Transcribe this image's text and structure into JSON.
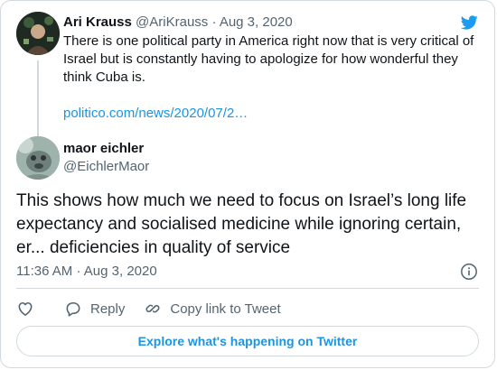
{
  "parent_tweet": {
    "author_name": "Ari Krauss",
    "author_handle": "@AriKrauss",
    "separator": "·",
    "date": "Aug 3, 2020",
    "text": "There is one political party in America right now that is very critical of Israel but is constantly having to apologize for how wonderful they think Cuba is.",
    "link": "politico.com/news/2020/07/2…"
  },
  "main_tweet": {
    "author_name": "maor eichler",
    "author_handle": "@EichlerMaor",
    "text": "This shows how much we need to focus on Israel’s long life expectancy and socialised medicine while ignoring certain, er... deficiencies in quality of service",
    "time": "11:36 AM",
    "separator": "·",
    "date": "Aug 3, 2020"
  },
  "actions": {
    "reply_label": "Reply",
    "copy_link_label": "Copy link to Tweet"
  },
  "explore_label": "Explore what's happening on Twitter",
  "icons": {
    "brand": "twitter-bird-icon",
    "info": "info-icon",
    "like": "heart-icon",
    "reply": "reply-bubble-icon",
    "copy_link": "link-icon"
  },
  "colors": {
    "link": "#1b95e0",
    "secondary_text": "#536471",
    "primary_text": "#0f1419",
    "border": "#cfd9de"
  }
}
